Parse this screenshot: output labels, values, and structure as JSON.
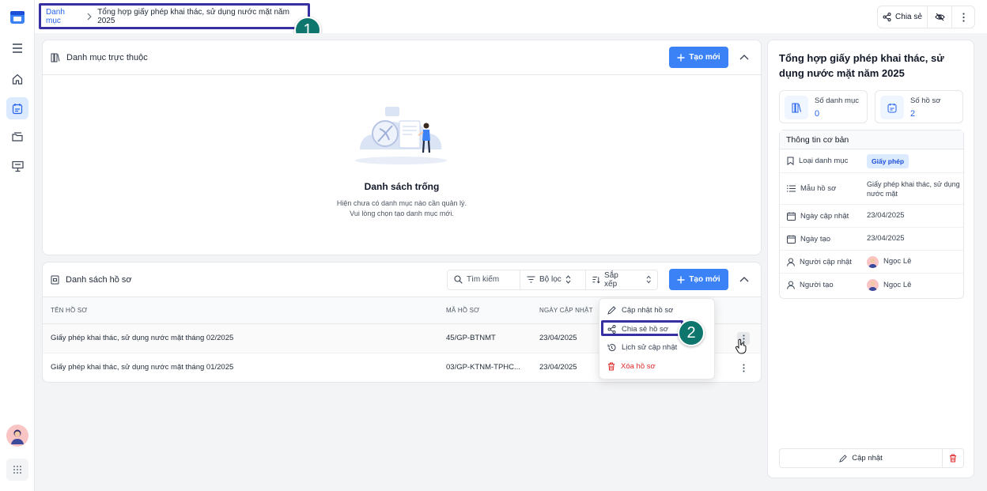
{
  "breadcrumb": {
    "root": "Danh mục",
    "current": "Tổng hợp giấy phép khai thác, sử dụng nước mặt năm 2025"
  },
  "callouts": {
    "one": "1",
    "two": "2"
  },
  "topbar": {
    "share_label": "Chia sẻ"
  },
  "sub_catalog": {
    "title": "Danh mục trực thuộc",
    "create_label": "Tạo mới",
    "empty_title": "Danh sách trống",
    "empty_line1": "Hiện chưa có danh mục nào cần quản lý.",
    "empty_line2": "Vui lòng chọn tạo danh mục mới."
  },
  "records": {
    "title": "Danh sách hồ sơ",
    "search_placeholder": "Tìm kiếm",
    "filter_label": "Bộ lọc",
    "sort_label": "Sắp xếp",
    "create_label": "Tạo mới",
    "columns": [
      "TÊN HỒ SƠ",
      "MÃ HỒ SƠ",
      "NGÀY CẬP NHẬT"
    ],
    "rows": [
      {
        "name": "Giấy phép khai thác, sử dụng nước mặt tháng 02/2025",
        "code": "45/GP-BTNMT",
        "updated": "23/04/2025"
      },
      {
        "name": "Giấy phép khai thác, sử dụng nước mặt tháng 01/2025",
        "code": "03/GP-KTNM-TPHC...",
        "updated": "23/04/2025"
      }
    ]
  },
  "context_menu": {
    "update": "Cập nhật hồ sơ",
    "share": "Chia sẻ hồ sơ",
    "history": "Lịch sử cập nhật",
    "delete": "Xóa hồ sơ"
  },
  "detail": {
    "title": "Tổng hợp giấy phép khai thác, sử dụng nước mặt năm 2025",
    "stat_catalog_label": "Số danh mục",
    "stat_catalog_value": "0",
    "stat_records_label": "Số hồ sơ",
    "stat_records_value": "2",
    "info_title": "Thông tin cơ bản",
    "type_key": "Loại danh mục",
    "type_value": "Giấy phép",
    "template_key": "Mẫu hồ sơ",
    "template_value": "Giấy phép khai thác, sử dụng nước mặt",
    "updated_key": "Ngày cập nhật",
    "updated_value": "23/04/2025",
    "created_key": "Ngày tạo",
    "created_value": "23/04/2025",
    "updater_key": "Người cập nhật",
    "updater_value": "Ngọc Lê",
    "creator_key": "Người tạo",
    "creator_value": "Ngọc Lê",
    "update_button": "Cập nhật"
  },
  "colors": {
    "primary": "#3b82f6",
    "callout": "#0f766e",
    "highlight": "#3730a3",
    "danger": "#dc2626"
  }
}
